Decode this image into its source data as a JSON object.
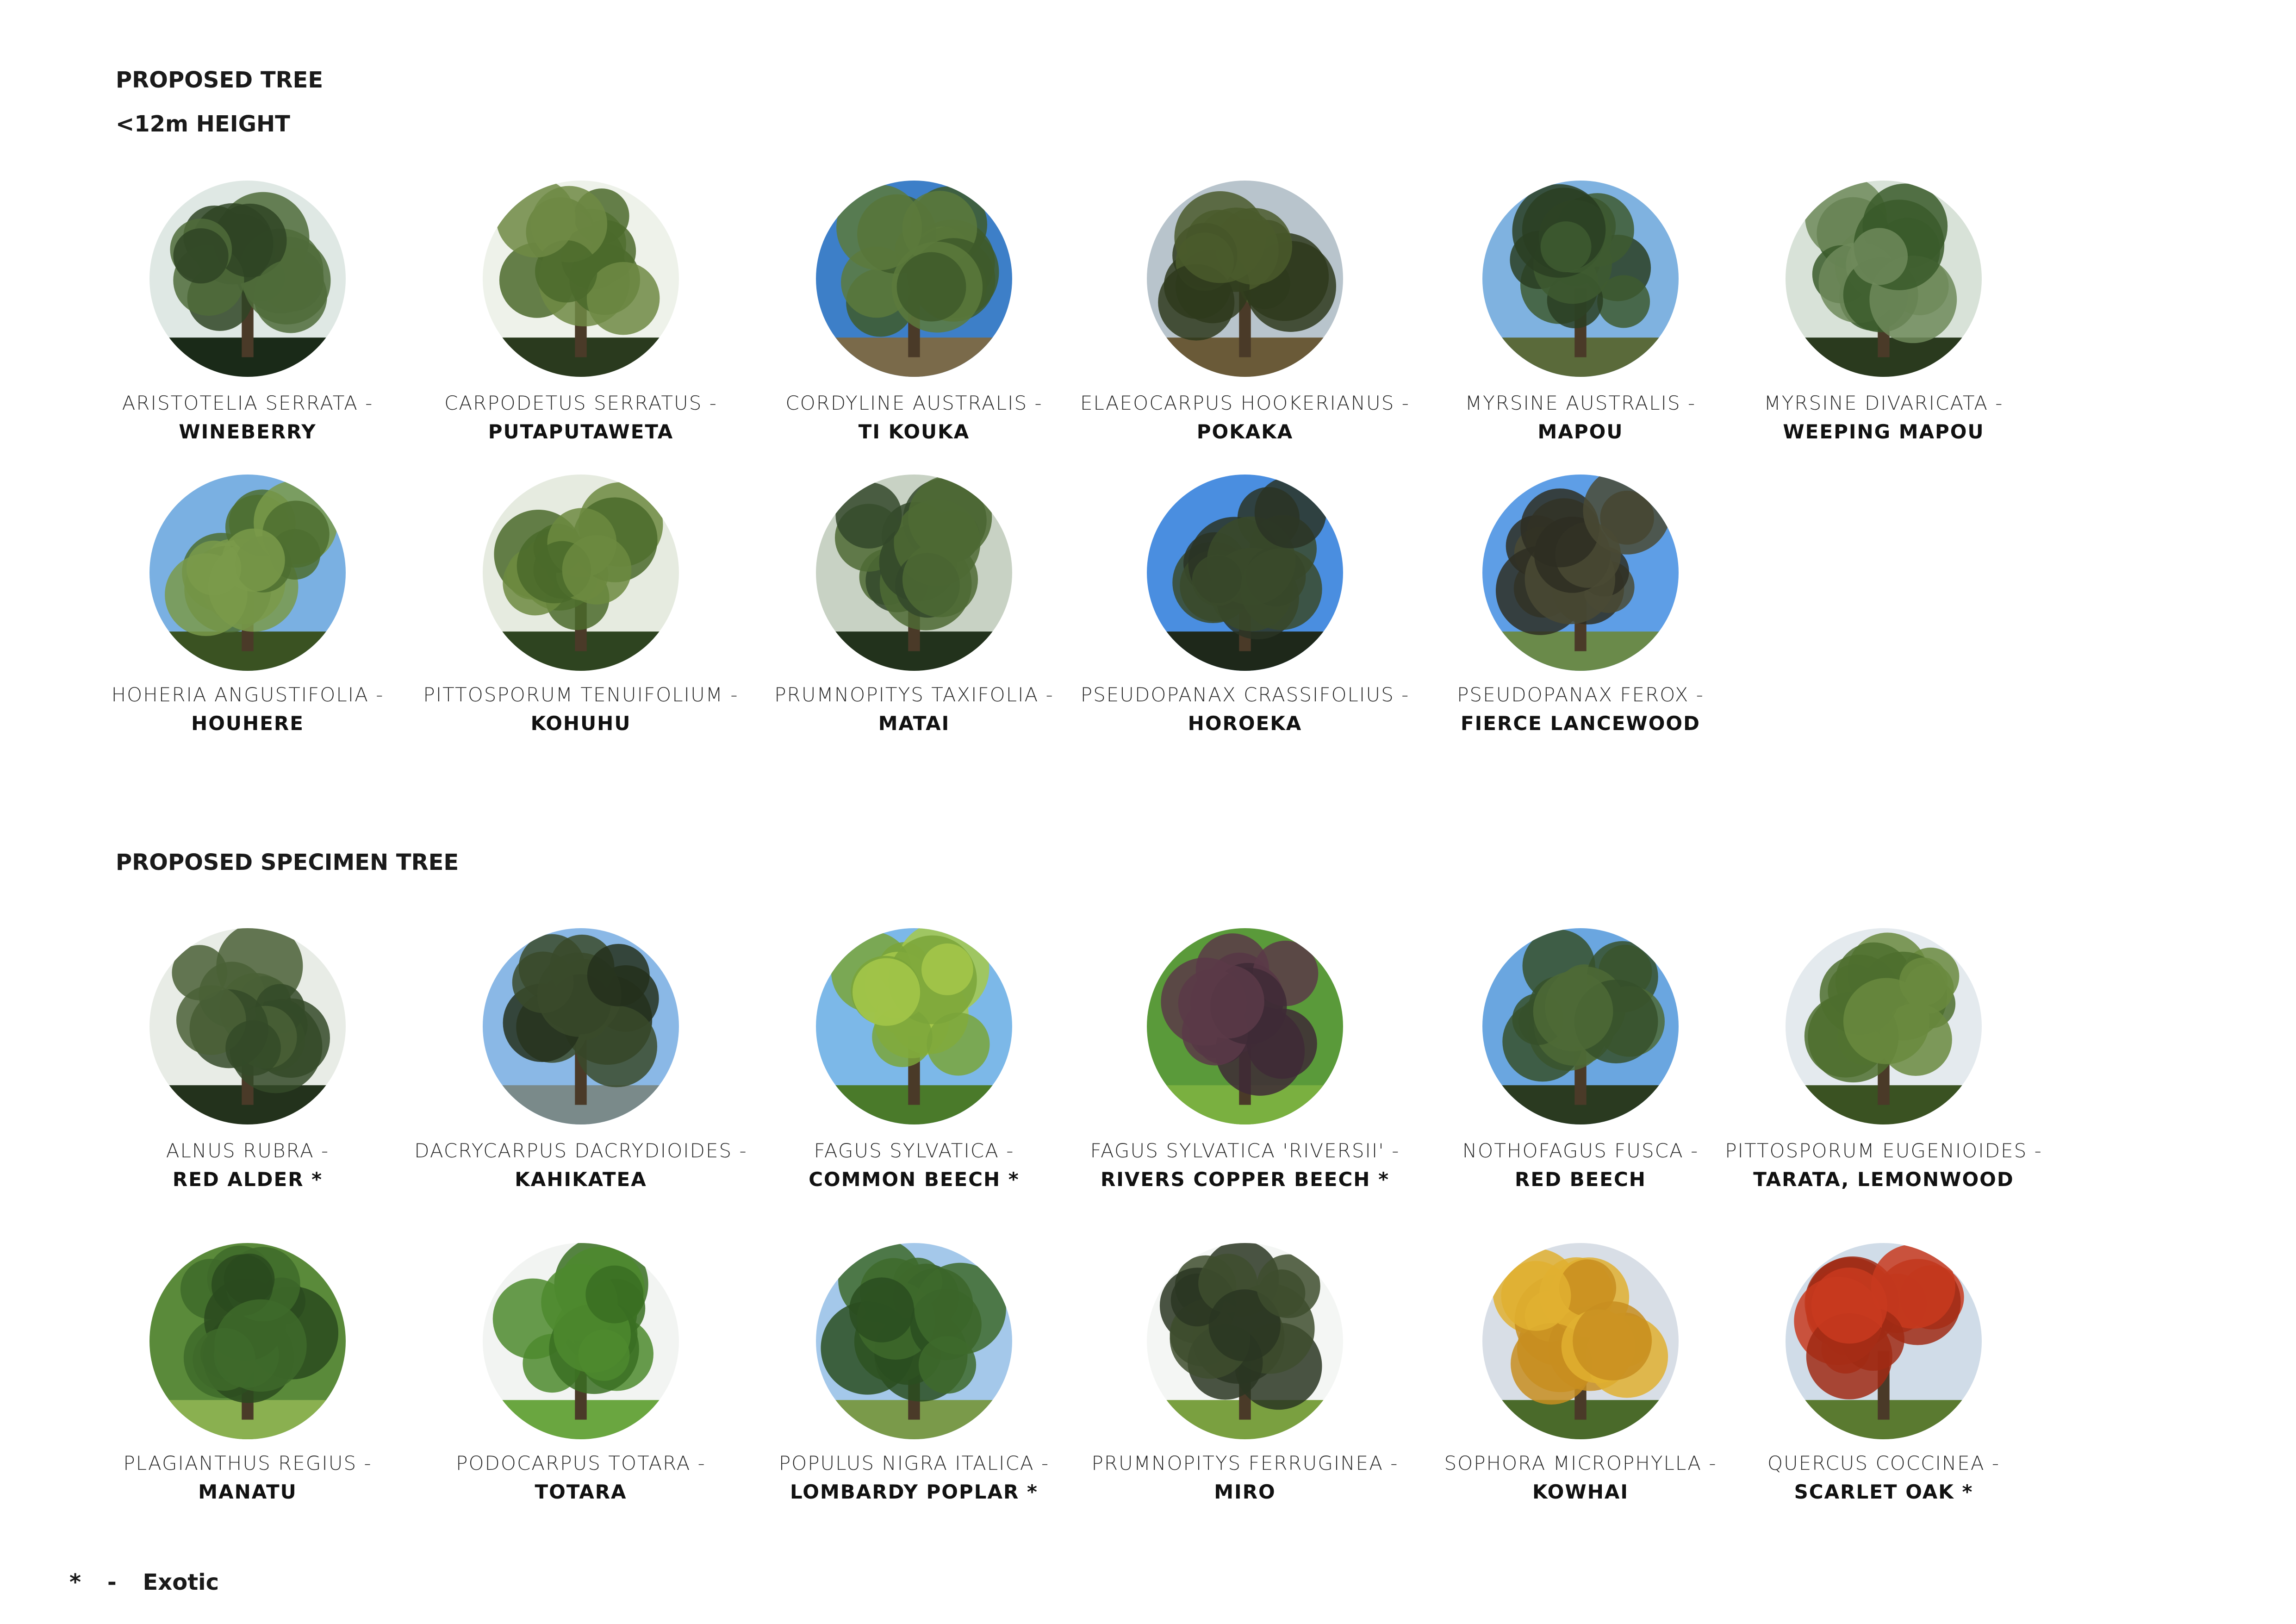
{
  "sections": [
    {
      "heading_lines": [
        "PROPOSED TREE",
        "<12m HEIGHT"
      ],
      "trees": [
        {
          "scientific": "ARISTOTELIA SERRATA -",
          "common": "WINEBERRY",
          "palette": [
            "#dfe8e4",
            "#4f6b3a",
            "#2f4424",
            "#1a2a18"
          ]
        },
        {
          "scientific": "CARPODETUS SERRATUS -",
          "common": "PUTAPUTAWETA",
          "palette": [
            "#eef2ea",
            "#6e8a44",
            "#4b6a2c",
            "#2a3a1e"
          ]
        },
        {
          "scientific": "CORDYLINE AUSTRALIS -",
          "common": "TI KOUKA",
          "palette": [
            "#3d7fc8",
            "#5c7a3c",
            "#3e5a2a",
            "#7a6a4a"
          ]
        },
        {
          "scientific": "ELAEOCARPUS HOOKERIANUS -",
          "common": "POKAKA",
          "palette": [
            "#b8c4cc",
            "#4a5a2c",
            "#2e3a1c",
            "#6a5a38"
          ]
        },
        {
          "scientific": "MYRSINE AUSTRALIS -",
          "common": "MAPOU",
          "palette": [
            "#7fb2e0",
            "#3e5a30",
            "#2a3e22",
            "#5a6a3a"
          ]
        },
        {
          "scientific": "MYRSINE DIVARICATA -",
          "common": "WEEPING MAPOU",
          "palette": [
            "#d8e2d8",
            "#6e8a5a",
            "#3a5a2a",
            "#2a3a1e"
          ]
        },
        {
          "scientific": "HOHERIA ANGUSTIFOLIA -",
          "common": "HOUHERE",
          "palette": [
            "#7ab0e2",
            "#7a9a4a",
            "#4e6e30",
            "#3a5222"
          ]
        },
        {
          "scientific": "PITTOSPORUM TENUIFOLIUM -",
          "common": "KOHUHU",
          "palette": [
            "#e6ebe0",
            "#6c8a40",
            "#4a6a2a",
            "#2e4420"
          ]
        },
        {
          "scientific": "PRUMNOPITYS TAXIFOLIA -",
          "common": "MATAI",
          "palette": [
            "#c8d2c4",
            "#4e6a34",
            "#33482a",
            "#22321c"
          ]
        },
        {
          "scientific": "PSEUDOPANAX CRASSIFOLIUS -",
          "common": "HOROEKA",
          "palette": [
            "#4a8ee0",
            "#3a4a2a",
            "#2a3424",
            "#1e281a"
          ]
        },
        {
          "scientific": "PSEUDOPANAX FEROX -",
          "common": "FIERCE LANCEWOOD",
          "palette": [
            "#5e9ee6",
            "#4a4a34",
            "#2e2e22",
            "#6a8a4a"
          ]
        }
      ]
    },
    {
      "heading_lines": [
        "PROPOSED SPECIMEN TREE"
      ],
      "trees": [
        {
          "scientific": "ALNUS RUBRA -",
          "common": "RED ALDER *",
          "palette": [
            "#e8ece6",
            "#4a6036",
            "#344a28",
            "#23321c"
          ]
        },
        {
          "scientific": "DACRYCARPUS DACRYDIOIDES -",
          "common": "KAHIKATEA",
          "palette": [
            "#8ab8e6",
            "#3a4a2a",
            "#24301c",
            "#7a8a8a"
          ]
        },
        {
          "scientific": "FAGUS SYLVATICA -",
          "common": "COMMON BEECH *",
          "palette": [
            "#7cb8e8",
            "#a6c84a",
            "#7aa43a",
            "#4a7a2a"
          ]
        },
        {
          "scientific": "FAGUS SYLVATICA 'RIVERSII' -",
          "common": "RIVERS COPPER BEECH *",
          "palette": [
            "#5a9a3a",
            "#5a3a48",
            "#3e2a36",
            "#7ab040"
          ]
        },
        {
          "scientific": "NOTHOFAGUS FUSCA -",
          "common": "RED BEECH",
          "palette": [
            "#6aa6e0",
            "#4e6a36",
            "#36502a",
            "#2a3a20"
          ]
        },
        {
          "scientific": "PITTOSPORUM EUGENIOIDES -",
          "common": "TARATA, LEMONWOOD",
          "palette": [
            "#e4eaee",
            "#6a8a3e",
            "#4e6e2e",
            "#3a5222"
          ]
        },
        {
          "scientific": "PLAGIANTHUS REGIUS -",
          "common": "MANATU",
          "palette": [
            "#5a8a3a",
            "#3e6a2a",
            "#2a4a1e",
            "#8ab050"
          ]
        },
        {
          "scientific": "PODOCARPUS TOTARA -",
          "common": "TOTARA",
          "palette": [
            "#f2f4f2",
            "#4e8a2e",
            "#3a6e22",
            "#6aa640"
          ]
        },
        {
          "scientific": "POPULUS NIGRA ITALICA -",
          "common": "LOMBARDY POPLAR *",
          "palette": [
            "#a4c8ea",
            "#3e6a2c",
            "#2a4e20",
            "#7a9a4a"
          ]
        },
        {
          "scientific": "PRUMNOPITYS FERRUGINEA -",
          "common": "MIRO",
          "palette": [
            "#f4f6f4",
            "#3e4e2e",
            "#2a3622",
            "#7aa040"
          ]
        },
        {
          "scientific": "SOPHORA MICROPHYLLA -",
          "common": "KOWHAI",
          "palette": [
            "#d8dee6",
            "#e0b030",
            "#c88e20",
            "#4a6a2a"
          ]
        },
        {
          "scientific": "QUERCUS COCCINEA -",
          "common": "SCARLET OAK *",
          "palette": [
            "#d0dce8",
            "#c83a1e",
            "#a02a14",
            "#5a7a30"
          ]
        }
      ]
    }
  ],
  "legend": {
    "symbol": "*",
    "dash": "-",
    "label": "Exotic"
  }
}
